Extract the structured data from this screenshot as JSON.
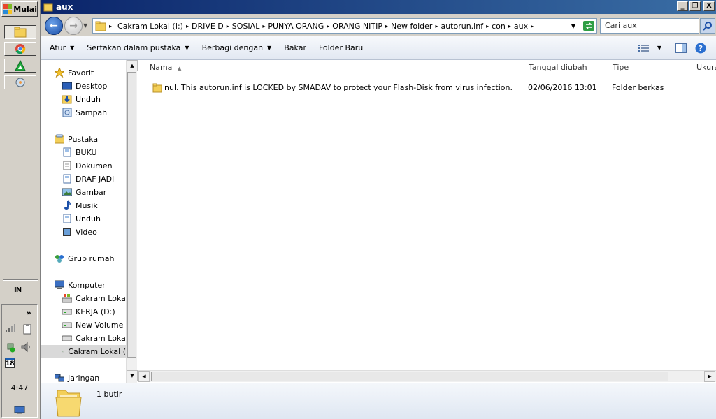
{
  "taskbar": {
    "start_label": "Mulai",
    "clock": "4:47",
    "calendar_day": "18",
    "tray_expand": "»"
  },
  "window": {
    "title": "aux",
    "caption_minimize": "_",
    "caption_maximize": "❐",
    "caption_close": "X"
  },
  "address": {
    "crumbs": [
      "Cakram Lokal (I:)",
      "DRIVE D",
      "SOSIAL",
      "PUNYA ORANG",
      "ORANG NITIP",
      "New folder",
      "autorun.inf",
      "con",
      "aux"
    ],
    "search_placeholder": "Cari aux"
  },
  "toolbar": {
    "organize": "Atur",
    "include_library": "Sertakan dalam pustaka",
    "share_with": "Berbagi dengan",
    "burn": "Bakar",
    "new_folder": "Folder Baru"
  },
  "navpane": {
    "favorites": "Favorit",
    "desktop": "Desktop",
    "downloads": "Unduh",
    "recent": "Sampah",
    "libraries": "Pustaka",
    "lib_buku": "BUKU",
    "lib_documents": "Dokumen",
    "lib_draf": "DRAF JADI",
    "lib_pictures": "Gambar",
    "lib_music": "Musik",
    "lib_downloads": "Unduh",
    "lib_videos": "Video",
    "homegroup": "Grup rumah",
    "computer": "Komputer",
    "drive_c": "Cakram Lokal (",
    "drive_d": "KERJA (D:)",
    "drive_e": "New Volume (E",
    "drive_f": "Cakram Lokal (",
    "drive_i": "Cakram Lokal (",
    "network": "Jaringan"
  },
  "columns": {
    "name": "Nama",
    "date": "Tanggal diubah",
    "type": "Tipe",
    "size": "Ukura"
  },
  "files": [
    {
      "name": "nul.  This autorun.inf is LOCKED by SMADAV to protect your Flash-Disk from virus infection.",
      "date": "02/06/2016 13:01",
      "type": "Folder berkas"
    }
  ],
  "details": {
    "item_count": "1 butir"
  }
}
